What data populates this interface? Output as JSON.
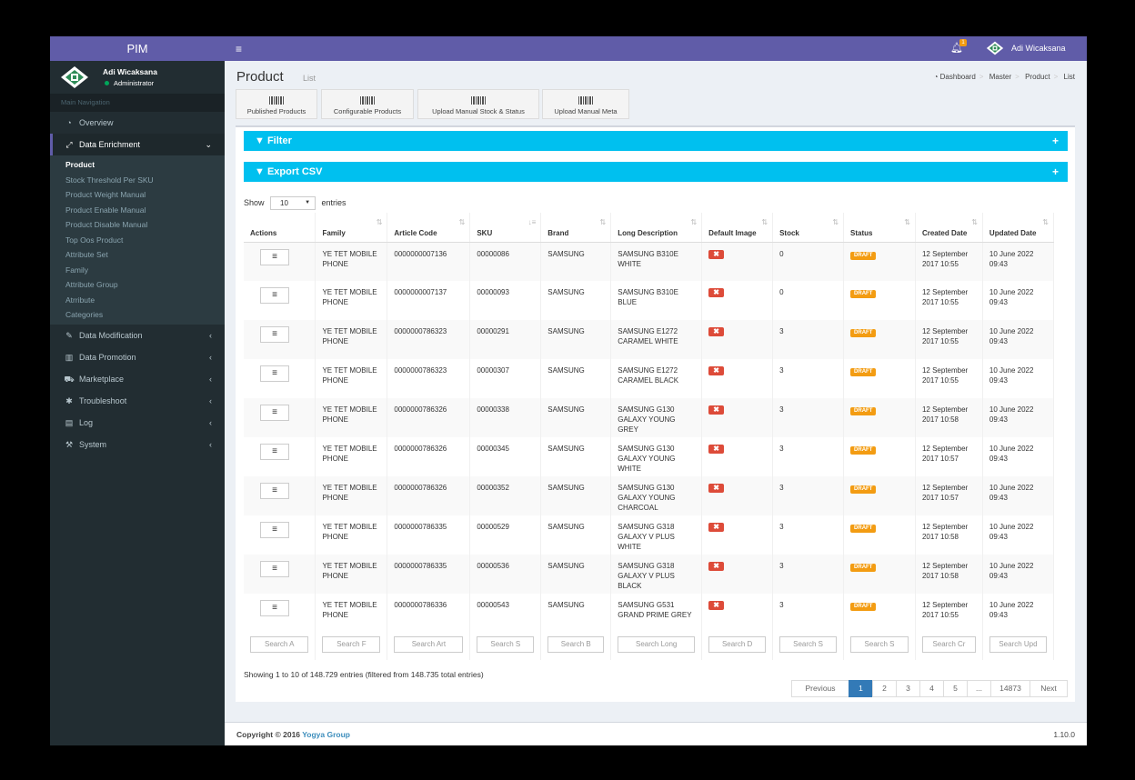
{
  "app": {
    "logo": "PIM"
  },
  "user": {
    "name": "Adi Wicaksana",
    "role": "Administrator",
    "status_color": "#00a65a",
    "notification_count": "1"
  },
  "colors": {
    "brand": "#605ca8",
    "sidebar": "#222d32",
    "info_bar": "#00c0ef",
    "danger": "#dd4b39",
    "warning": "#f39c12",
    "primary": "#337ab7"
  },
  "sidebar": {
    "header": "Main Navigation",
    "items": [
      {
        "label": "Overview",
        "icon": "dashboard-icon"
      },
      {
        "label": "Data Enrichment",
        "icon": "share-icon",
        "expanded": true
      },
      {
        "label": "Data Modification",
        "icon": "edit-icon"
      },
      {
        "label": "Data Promotion",
        "icon": "bar-chart-icon"
      },
      {
        "label": "Marketplace",
        "icon": "cart-icon"
      },
      {
        "label": "Troubleshoot",
        "icon": "bug-icon"
      },
      {
        "label": "Log",
        "icon": "list-icon"
      },
      {
        "label": "System",
        "icon": "wrench-icon"
      }
    ],
    "subitems": [
      "Product",
      "Stock Threshold Per SKU",
      "Product Weight Manual",
      "Product Enable Manual",
      "Product Disable Manual",
      "Top Oos Product",
      "Attribute Set",
      "Family",
      "Attribute Group",
      "Atrribute",
      "Categories"
    ]
  },
  "page": {
    "title": "Product",
    "subtitle": "List"
  },
  "breadcrumb": [
    "Dashboard",
    "Master",
    "Product",
    "List"
  ],
  "toolbar": [
    "Published Products",
    "Configurable Products",
    "Upload Manual Stock & Status",
    "Upload Manual Meta"
  ],
  "filter": {
    "label": "Filter"
  },
  "export": {
    "label": "Export CSV"
  },
  "length": {
    "show": "Show",
    "value": "10",
    "entries": "entries"
  },
  "table": {
    "headers": [
      "Actions",
      "Family",
      "Article Code",
      "SKU",
      "Brand",
      "Long Description",
      "Default Image",
      "Stock",
      "Status",
      "Created Date",
      "Updated Date"
    ],
    "rows": [
      {
        "family": "YE TET MOBILE PHONE",
        "article": "0000000007136",
        "sku": "00000086",
        "brand": "SAMSUNG",
        "desc": "SAMSUNG B310E WHITE",
        "image": "✖",
        "stock": "0",
        "status": "DRAFT",
        "created": "12 September 2017 10:55",
        "updated": "10 June 2022 09:43"
      },
      {
        "family": "YE TET MOBILE PHONE",
        "article": "0000000007137",
        "sku": "00000093",
        "brand": "SAMSUNG",
        "desc": "SAMSUNG B310E BLUE",
        "image": "✖",
        "stock": "0",
        "status": "DRAFT",
        "created": "12 September 2017 10:55",
        "updated": "10 June 2022 09:43"
      },
      {
        "family": "YE TET MOBILE PHONE",
        "article": "0000000786323",
        "sku": "00000291",
        "brand": "SAMSUNG",
        "desc": "SAMSUNG E1272 CARAMEL WHITE",
        "image": "✖",
        "stock": "3",
        "status": "DRAFT",
        "created": "12 September 2017 10:55",
        "updated": "10 June 2022 09:43"
      },
      {
        "family": "YE TET MOBILE PHONE",
        "article": "0000000786323",
        "sku": "00000307",
        "brand": "SAMSUNG",
        "desc": "SAMSUNG E1272 CARAMEL BLACK",
        "image": "✖",
        "stock": "3",
        "status": "DRAFT",
        "created": "12 September 2017 10:55",
        "updated": "10 June 2022 09:43"
      },
      {
        "family": "YE TET MOBILE PHONE",
        "article": "0000000786326",
        "sku": "00000338",
        "brand": "SAMSUNG",
        "desc": "SAMSUNG G130 GALAXY YOUNG GREY",
        "image": "✖",
        "stock": "3",
        "status": "DRAFT",
        "created": "12 September 2017 10:58",
        "updated": "10 June 2022 09:43"
      },
      {
        "family": "YE TET MOBILE PHONE",
        "article": "0000000786326",
        "sku": "00000345",
        "brand": "SAMSUNG",
        "desc": "SAMSUNG G130 GALAXY YOUNG WHITE",
        "image": "✖",
        "stock": "3",
        "status": "DRAFT",
        "created": "12 September 2017 10:57",
        "updated": "10 June 2022 09:43"
      },
      {
        "family": "YE TET MOBILE PHONE",
        "article": "0000000786326",
        "sku": "00000352",
        "brand": "SAMSUNG",
        "desc": "SAMSUNG G130 GALAXY YOUNG CHARCOAL",
        "image": "✖",
        "stock": "3",
        "status": "DRAFT",
        "created": "12 September 2017 10:57",
        "updated": "10 June 2022 09:43"
      },
      {
        "family": "YE TET MOBILE PHONE",
        "article": "0000000786335",
        "sku": "00000529",
        "brand": "SAMSUNG",
        "desc": "SAMSUNG G318 GALAXY V PLUS WHITE",
        "image": "✖",
        "stock": "3",
        "status": "DRAFT",
        "created": "12 September 2017 10:58",
        "updated": "10 June 2022 09:43"
      },
      {
        "family": "YE TET MOBILE PHONE",
        "article": "0000000786335",
        "sku": "00000536",
        "brand": "SAMSUNG",
        "desc": "SAMSUNG G318 GALAXY V PLUS BLACK",
        "image": "✖",
        "stock": "3",
        "status": "DRAFT",
        "created": "12 September 2017 10:58",
        "updated": "10 June 2022 09:43"
      },
      {
        "family": "YE TET MOBILE PHONE",
        "article": "0000000786336",
        "sku": "00000543",
        "brand": "SAMSUNG",
        "desc": "SAMSUNG G531 GRAND PRIME GREY",
        "image": "✖",
        "stock": "3",
        "status": "DRAFT",
        "created": "12 September 2017 10:55",
        "updated": "10 June 2022 09:43"
      }
    ],
    "search_placeholders": [
      "Search A",
      "Search F",
      "Search Art",
      "Search S",
      "Search B",
      "Search Long",
      "Search D",
      "Search S",
      "Search S",
      "Search Cr",
      "Search Upd"
    ]
  },
  "info": "Showing 1 to 10 of 148.729 entries (filtered from 148.735 total entries)",
  "pagination": [
    "Previous",
    "1",
    "2",
    "3",
    "4",
    "5",
    "...",
    "14873",
    "Next"
  ],
  "pagination_active": "1",
  "footer": {
    "copyright": "Copyright © 2016",
    "company": "Yogya Group",
    "version": "1.10.0"
  }
}
